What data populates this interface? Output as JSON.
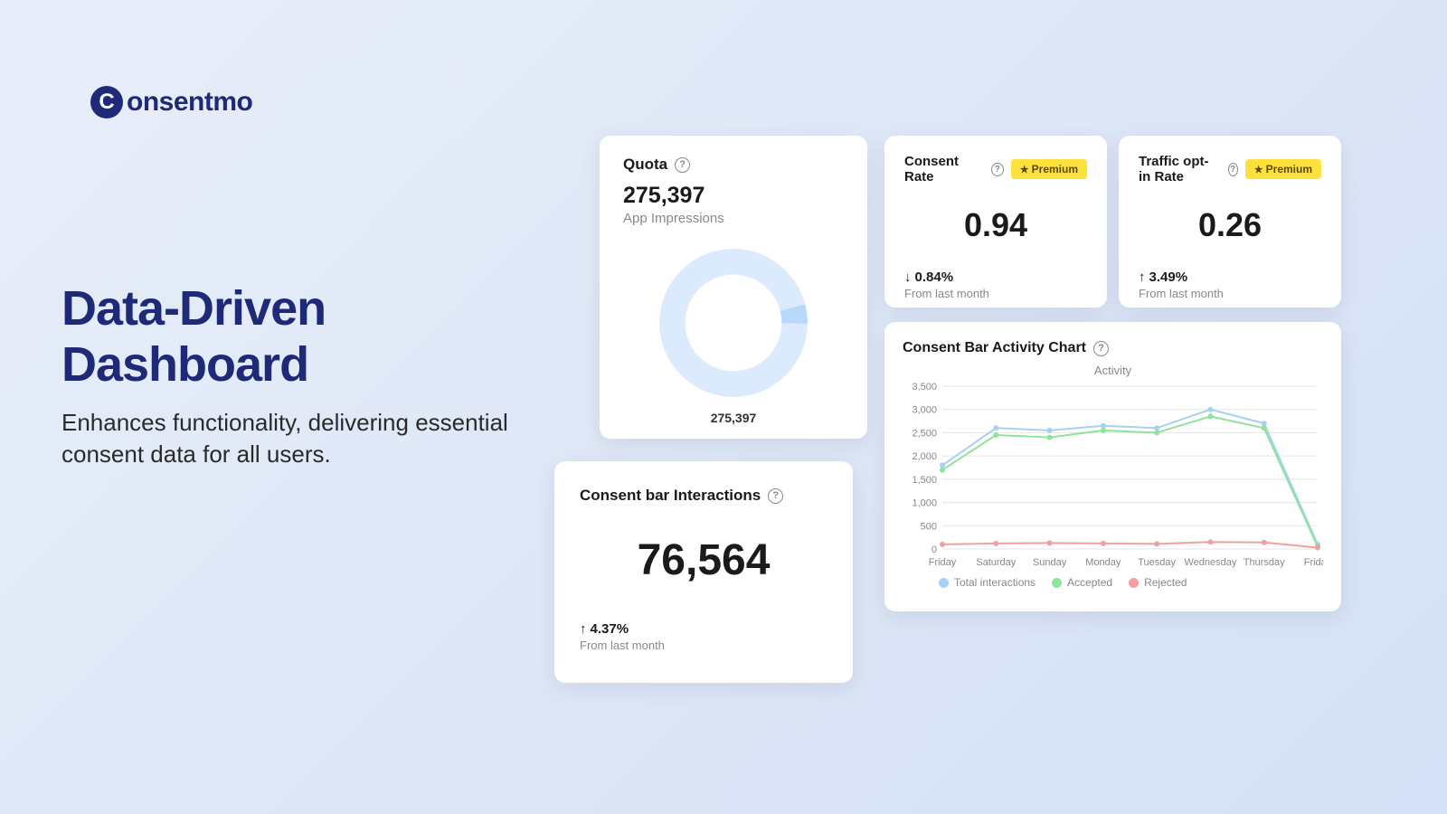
{
  "brand": {
    "name": "onsentmo"
  },
  "hero": {
    "title": "Data-Driven Dashboard",
    "subtitle": "Enhances functionality, delivering essential consent data for all users."
  },
  "quota": {
    "title": "Quota",
    "value": "275,397",
    "subtitle": "App Impressions",
    "donut_label": "275,397"
  },
  "interactions": {
    "title": "Consent bar Interactions",
    "value": "76,564",
    "delta": "4.37%",
    "delta_dir": "up",
    "delta_sub": "From last month"
  },
  "consent_rate": {
    "title": "Consent Rate",
    "value": "0.94",
    "delta": "0.84%",
    "delta_dir": "down",
    "delta_sub": "From last month",
    "badge": "Premium"
  },
  "traffic_rate": {
    "title": "Traffic opt-in Rate",
    "value": "0.26",
    "delta": "3.49%",
    "delta_dir": "up",
    "delta_sub": "From last month",
    "badge": "Premium"
  },
  "activity_chart": {
    "title": "Consent Bar Activity Chart",
    "inner_title": "Activity",
    "legend": [
      "Total interactions",
      "Accepted",
      "Rejected"
    ]
  },
  "chart_data": {
    "type": "line",
    "categories": [
      "Friday",
      "Saturday",
      "Sunday",
      "Monday",
      "Tuesday",
      "Wednesday",
      "Thursday",
      "Friday"
    ],
    "series": [
      {
        "name": "Total interactions",
        "values": [
          1800,
          2600,
          2550,
          2650,
          2600,
          3000,
          2700,
          100
        ],
        "color": "#a8d0f0"
      },
      {
        "name": "Accepted",
        "values": [
          1700,
          2450,
          2400,
          2550,
          2500,
          2850,
          2600,
          50
        ],
        "color": "#8de49a"
      },
      {
        "name": "Rejected",
        "values": [
          100,
          120,
          130,
          120,
          110,
          150,
          140,
          30
        ],
        "color": "#f0a0a0"
      }
    ],
    "ylim": [
      0,
      3500
    ],
    "yticks": [
      0,
      500,
      1000,
      1500,
      2000,
      2500,
      3000,
      3500
    ],
    "xlabel": "",
    "ylabel": ""
  }
}
